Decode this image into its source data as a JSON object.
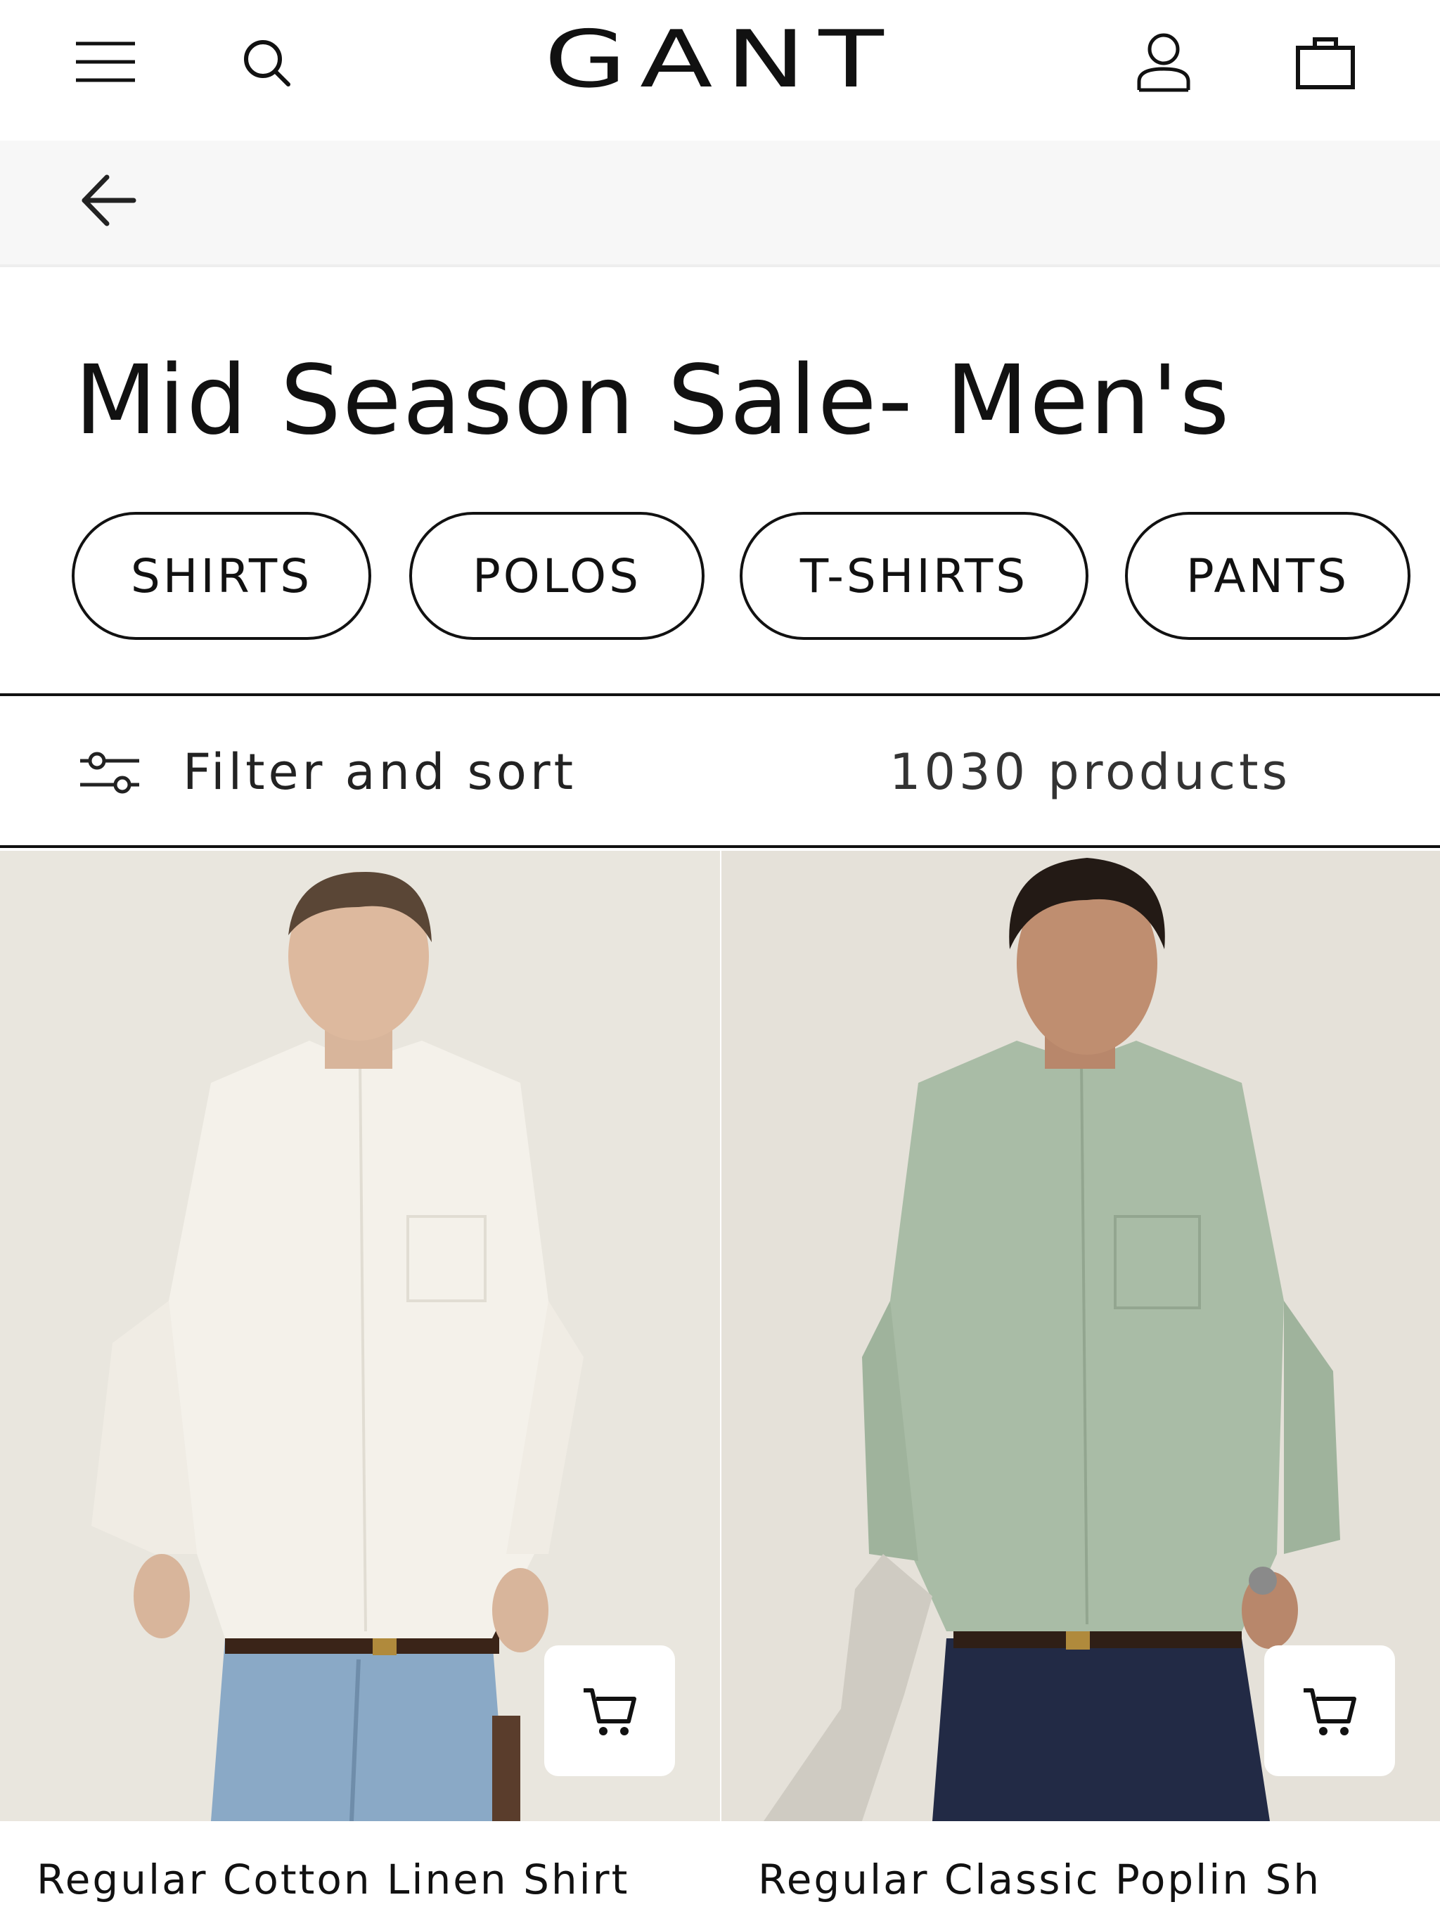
{
  "header": {
    "logo": "GANT",
    "icons": [
      "menu-icon",
      "search-icon",
      "account-icon",
      "bag-icon"
    ]
  },
  "nav": {
    "back_icon": "arrow-left-icon"
  },
  "page": {
    "title": "Mid Season Sale- Men's"
  },
  "categories": [
    {
      "label": "SHIRTS"
    },
    {
      "label": "POLOS"
    },
    {
      "label": "T-SHIRTS"
    },
    {
      "label": "PANTS"
    }
  ],
  "toolbar": {
    "filter_label": "Filter and sort",
    "product_count": "1030 products"
  },
  "products": [
    {
      "name": "Regular Cotton Linen Shirt",
      "shirt_color": "#f4f1ea",
      "jeans_color": "#8aa9c6"
    },
    {
      "name": "Regular Classic Poplin Sh",
      "shirt_color": "#a9bca6",
      "jeans_color": "#222a45"
    }
  ],
  "colors": {
    "background_photo": "#e6e2da",
    "text": "#111111",
    "subbar": "#f7f7f7"
  }
}
